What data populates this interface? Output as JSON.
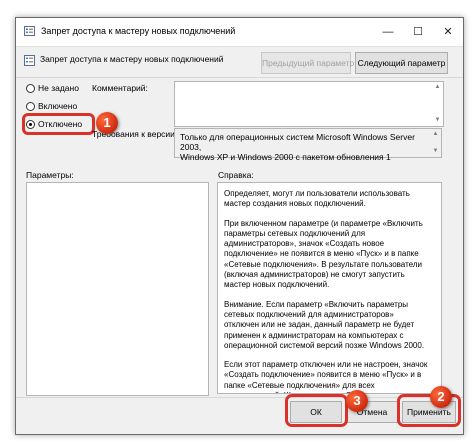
{
  "window": {
    "title": "Запрет доступа к мастеру новых подключений",
    "controls": {
      "minimize": "—",
      "maximize": "☐",
      "close": "✕"
    }
  },
  "header": {
    "policy_name": "Запрет доступа к мастеру новых подключений",
    "prev_label": "Предыдущий параметр",
    "next_label": "Следующий параметр"
  },
  "state_options": [
    {
      "label": "Не задано",
      "selected": false
    },
    {
      "label": "Включено",
      "selected": false
    },
    {
      "label": "Отключено",
      "selected": true
    }
  ],
  "comment": {
    "label": "Комментарий:",
    "value": ""
  },
  "requirements": {
    "label": "Требования к версии:",
    "line1": "Только для операционных систем Microsoft Windows Server 2003,",
    "line2": "Windows XP и Windows 2000 с пакетом обновления 1"
  },
  "params_label": "Параметры:",
  "help_label": "Справка:",
  "help_text": [
    "Определяет, могут ли пользователи использовать мастер создания новых подключений.",
    "При включенном параметре (и параметре «Включить параметры сетевых подключений для администраторов», значок «Создать новое подключение» не появится в меню «Пуск» и в папке «Сетевые подключения». В результате пользователи (включая администраторов) не смогут запустить мастер новых подключений.",
    "Внимание. Если параметр «Включить параметры сетевых подключений для администраторов» отключен или не задан, данный параметр не будет применен к администраторам на компьютерах с операционной системой версий позже Windows 2000.",
    "Если этот параметр отключен или не настроен, значок «Создать подключение» появится в меню «Пуск» и в папке «Сетевые подключения» для всех пользователей. Щелчок значка «Создать подключение» запускает мастер подключения."
  ],
  "buttons": {
    "ok": "ОК",
    "cancel": "Отмена",
    "apply": "Применить"
  },
  "badges": {
    "one": "1",
    "two": "2",
    "three": "3"
  },
  "colors": {
    "annotation_red": "#d8322b",
    "window_bg": "#f0f0f0"
  }
}
